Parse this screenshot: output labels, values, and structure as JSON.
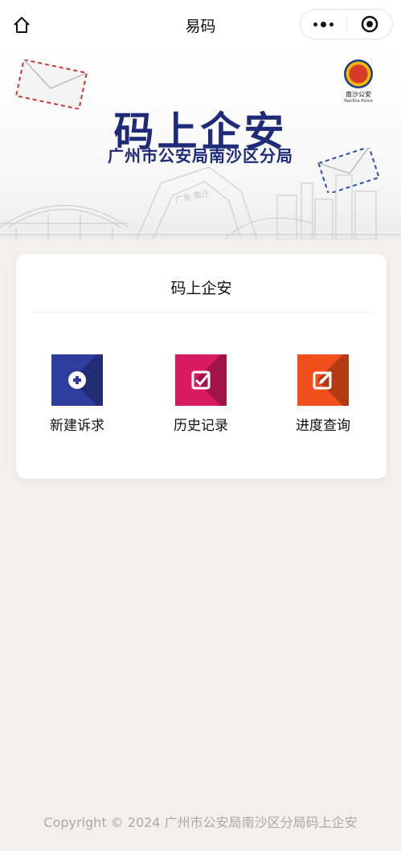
{
  "navbar": {
    "title": "易码",
    "home_icon": "home-icon",
    "more_icon": "more-dots-icon",
    "close_icon": "target-circle-icon"
  },
  "banner": {
    "title": "码上企安",
    "subtitle": "广州市公安局南沙区分局",
    "badge_text": "南沙公安",
    "badge_subtext": "NanSha Police",
    "skyline_text": "广东·南沙",
    "title_color": "#1f2a78"
  },
  "card": {
    "title": "码上企安",
    "items": [
      {
        "label": "新建诉求",
        "icon": "plus-circle-icon",
        "color": "#2f3d9e"
      },
      {
        "label": "历史记录",
        "icon": "check-box-icon",
        "color": "#d81b60"
      },
      {
        "label": "进度查询",
        "icon": "edit-pencil-icon",
        "color": "#f04e1a"
      }
    ]
  },
  "footer": {
    "copyright": "Copyright © 2024 广州市公安局南沙区分局码上企安"
  }
}
